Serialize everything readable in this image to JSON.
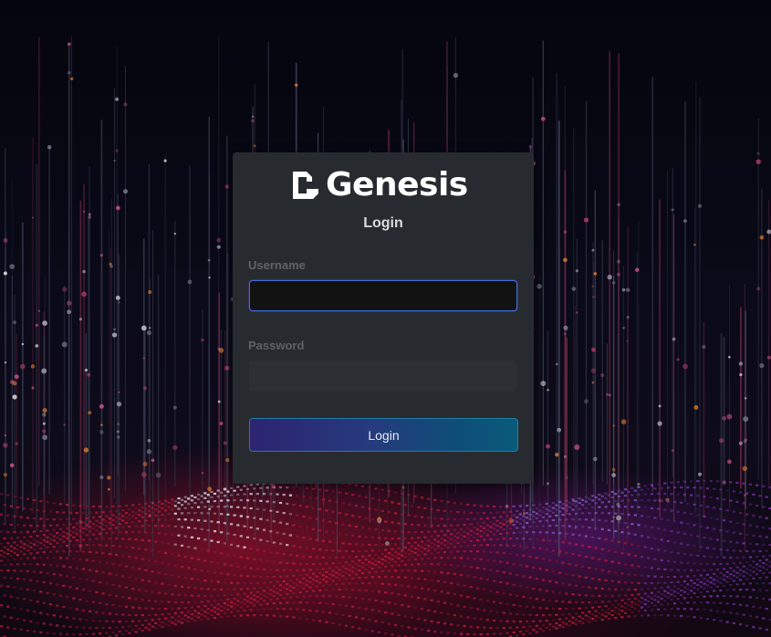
{
  "brand": {
    "name": "Genesis",
    "logo_icon": "genesis-logo-icon",
    "logo_color": "#ffffff"
  },
  "form": {
    "title": "Login",
    "username_label": "Username",
    "username_value": "",
    "password_label": "Password",
    "password_value": "",
    "submit_label": "Login"
  },
  "colors": {
    "panel_bg": "#272b2f",
    "button_gradient_start": "#2d2470",
    "button_gradient_end": "#0a5a7a",
    "focus_border": "#3f6fd8",
    "background": "#06060f"
  }
}
